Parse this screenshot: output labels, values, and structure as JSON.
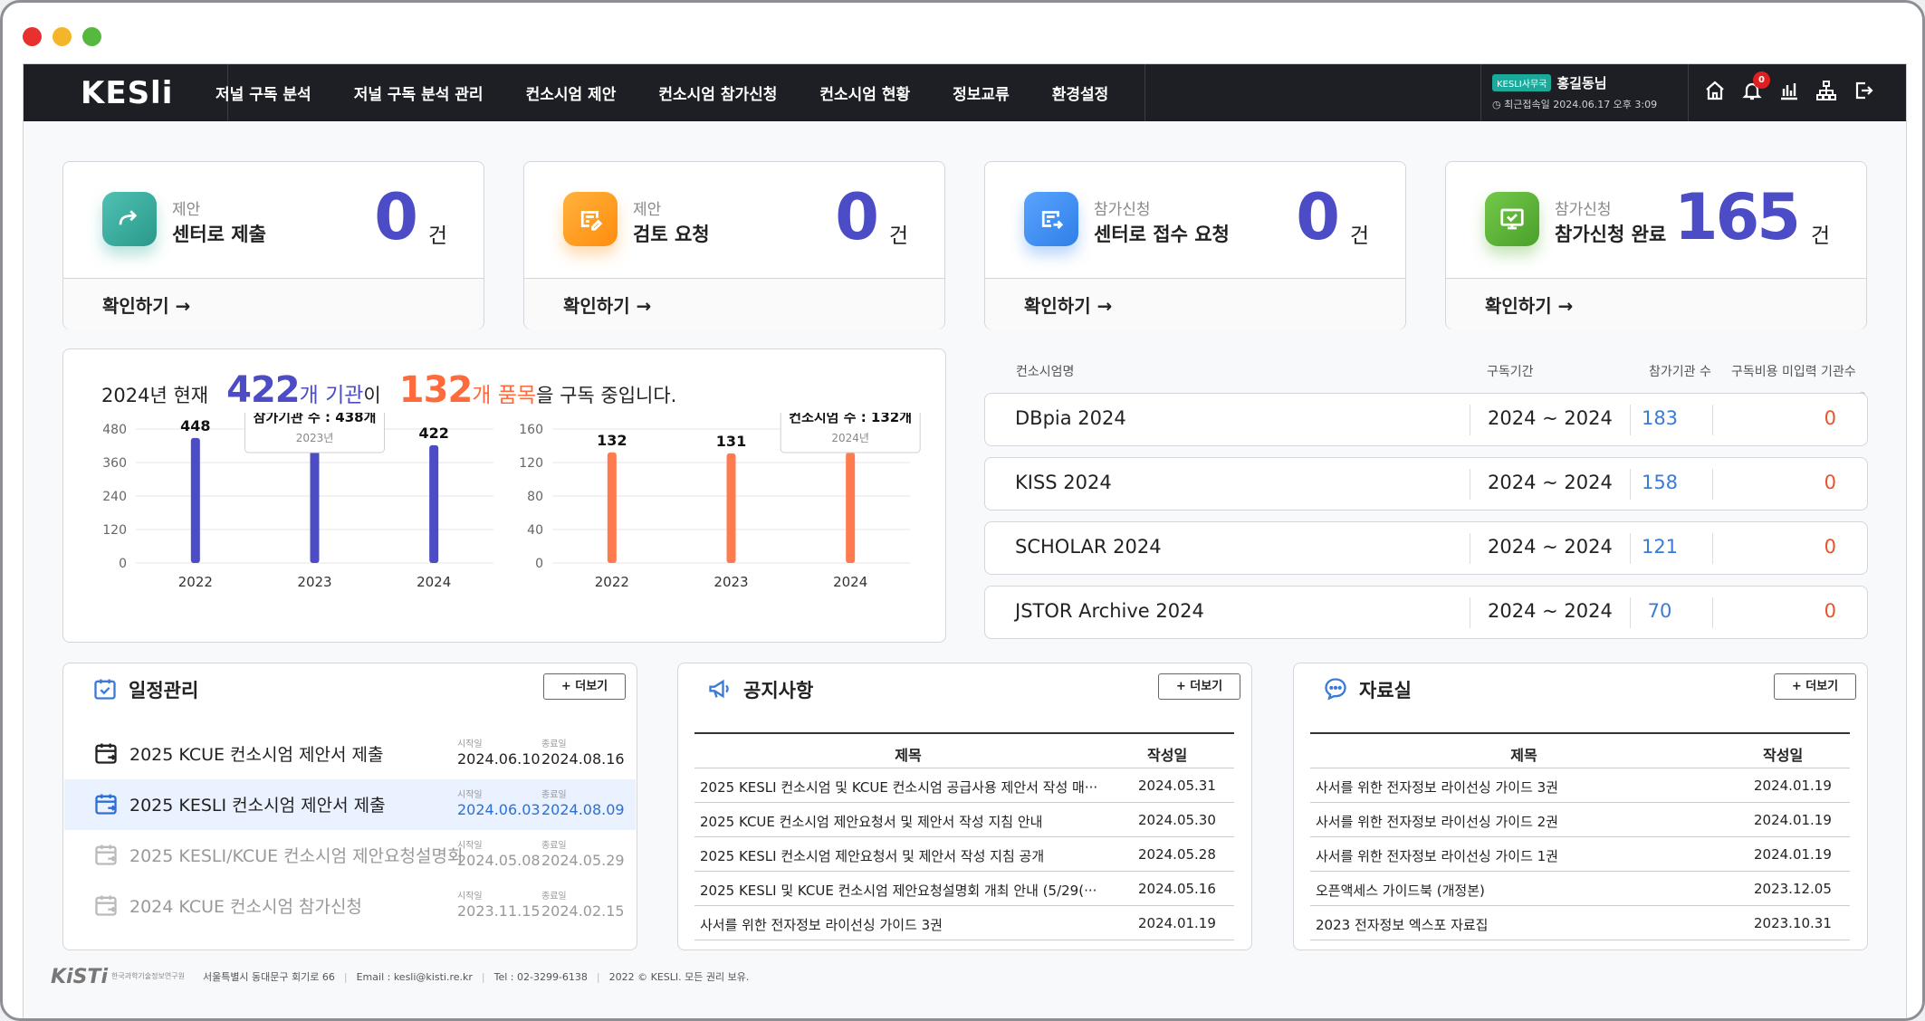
{
  "window": {
    "dots": [
      "#e8312f",
      "#f5b52a",
      "#57b83f"
    ]
  },
  "nav": {
    "logo": "KESli",
    "menu": [
      "저널 구독 분석",
      "저널 구독 분석 관리",
      "컨소시엄 제안",
      "컨소시엄 참가신청",
      "컨소시엄 현황",
      "정보교류",
      "환경설정"
    ],
    "org_badge": "KESLI사무국",
    "user_name": "홍길동님",
    "last_login": "최근접속일  2024.06.17 오후 3:09",
    "notification_count": "0",
    "icons": [
      "home-icon",
      "bell-icon",
      "bar-chart-icon",
      "sitemap-icon",
      "logout-icon"
    ]
  },
  "stats": [
    {
      "category": "제안",
      "label": "센터로 제출",
      "value": "0",
      "unit": "건",
      "link": "확인하기 →",
      "color": "#3aaea0",
      "icon": "send-icon"
    },
    {
      "category": "제안",
      "label": "검토 요청",
      "value": "0",
      "unit": "건",
      "link": "확인하기 →",
      "color": "#ff9a1c",
      "icon": "edit-document-icon"
    },
    {
      "category": "참가신청",
      "label": "센터로 접수 요청",
      "value": "0",
      "unit": "건",
      "link": "확인하기 →",
      "color": "#3d8ff0",
      "icon": "transfer-document-icon"
    },
    {
      "category": "참가신청",
      "label": "참가신청 완료",
      "value": "165",
      "unit": "건",
      "link": "확인하기 →",
      "color": "#5cb434",
      "icon": "monitor-check-icon"
    }
  ],
  "headline": {
    "year_text": "2024년 현재",
    "inst_num": "422",
    "inst_unit": "개 기관",
    "inst_tail": "이",
    "item_num": "132",
    "item_unit": "개 품목",
    "item_tail": "을 구독 중입니다."
  },
  "chart_data": [
    {
      "type": "bar",
      "categories": [
        "2022",
        "2023",
        "2024"
      ],
      "values": [
        448,
        438,
        422
      ],
      "yticks": [
        0,
        120,
        240,
        360,
        480
      ],
      "ylim": [
        0,
        480
      ],
      "color": "#4b4cc6",
      "value_labels": [
        "448",
        "",
        "422"
      ],
      "tooltip": {
        "title": "참가기관 수 : 438개",
        "sub": "2023년",
        "index": 1
      }
    },
    {
      "type": "bar",
      "categories": [
        "2022",
        "2023",
        "2024"
      ],
      "values": [
        132,
        131,
        132
      ],
      "yticks": [
        0,
        40,
        80,
        120,
        160
      ],
      "ylim": [
        0,
        160
      ],
      "color": "#ff7a4d",
      "value_labels": [
        "132",
        "131",
        ""
      ],
      "tooltip": {
        "title": "컨소시엄 수 : 132개",
        "sub": "2024년",
        "index": 2
      }
    }
  ],
  "consortium_table": {
    "headers": [
      "컨소시엄명",
      "구독기간",
      "참가기관 수",
      "구독비용 미입력 기관수"
    ],
    "rows": [
      {
        "name": "DBpia 2024",
        "period": "2024 ~ 2024",
        "count": "183",
        "missing": "0"
      },
      {
        "name": "KISS 2024",
        "period": "2024 ~ 2024",
        "count": "158",
        "missing": "0"
      },
      {
        "name": "SCHOLAR 2024",
        "period": "2024 ~ 2024",
        "count": "121",
        "missing": "0"
      },
      {
        "name": "JSTOR Archive 2024",
        "period": "2024 ~ 2024",
        "count": "70",
        "missing": "0"
      }
    ]
  },
  "schedule": {
    "title": "일정관리",
    "more": "+ 더보기",
    "start_label": "시작일",
    "end_label": "종료일",
    "items": [
      {
        "title": "2025 KCUE 컨소시엄 제안서 제출",
        "start": "2024.06.10",
        "end": "2024.08.16",
        "state": "active"
      },
      {
        "title": "2025 KESLI 컨소시엄 제안서 제출",
        "start": "2024.06.03",
        "end": "2024.08.09",
        "state": "selected"
      },
      {
        "title": "2025 KESLI/KCUE 컨소시엄 제안요청설명회",
        "start": "2024.05.08",
        "end": "2024.05.29",
        "state": "past"
      },
      {
        "title": "2024 KCUE 컨소시엄 참가신청",
        "start": "2023.11.15",
        "end": "2024.02.15",
        "state": "past"
      }
    ]
  },
  "notice": {
    "title": "공지사항",
    "more": "+ 더보기",
    "col_title": "제목",
    "col_date": "작성일",
    "rows": [
      {
        "title": "2025 KESLI 컨소시엄 및 KCUE 컨소시엄 공급사용 제안서 작성 매···",
        "date": "2024.05.31"
      },
      {
        "title": "2025 KCUE 컨소시엄 제안요청서 및 제안서 작성 지침 안내",
        "date": "2024.05.30"
      },
      {
        "title": "2025 KESLI 컨소시엄 제안요청서 및 제안서 작성 지침 공개",
        "date": "2024.05.28"
      },
      {
        "title": "2025 KESLI 및 KCUE 컨소시엄 제안요청설명회 개최 안내 (5/29(···",
        "date": "2024.05.16"
      },
      {
        "title": "사서를 위한 전자정보 라이선싱 가이드 3권",
        "date": "2024.01.19"
      }
    ]
  },
  "archive": {
    "title": "자료실",
    "more": "+ 더보기",
    "col_title": "제목",
    "col_date": "작성일",
    "rows": [
      {
        "title": "사서를 위한 전자정보 라이선싱 가이드 3권",
        "date": "2024.01.19"
      },
      {
        "title": "사서를 위한 전자정보 라이선싱 가이드 2권",
        "date": "2024.01.19"
      },
      {
        "title": "사서를 위한 전자정보 라이선싱 가이드 1권",
        "date": "2024.01.19"
      },
      {
        "title": "오픈액세스 가이드북 (개정본)",
        "date": "2023.12.05"
      },
      {
        "title": "2023 전자정보 엑스포 자료집",
        "date": "2023.10.31"
      }
    ]
  },
  "footer": {
    "logo": "KiSTi",
    "org": "한국과학기술정보연구원",
    "address": "서울특별시 동대문구 회기로 66",
    "email": "Email : kesli@kisti.re.kr",
    "tel": "Tel : 02-3299-6138",
    "copyright": "2022 © KESLI. 모든 권리 보유."
  }
}
